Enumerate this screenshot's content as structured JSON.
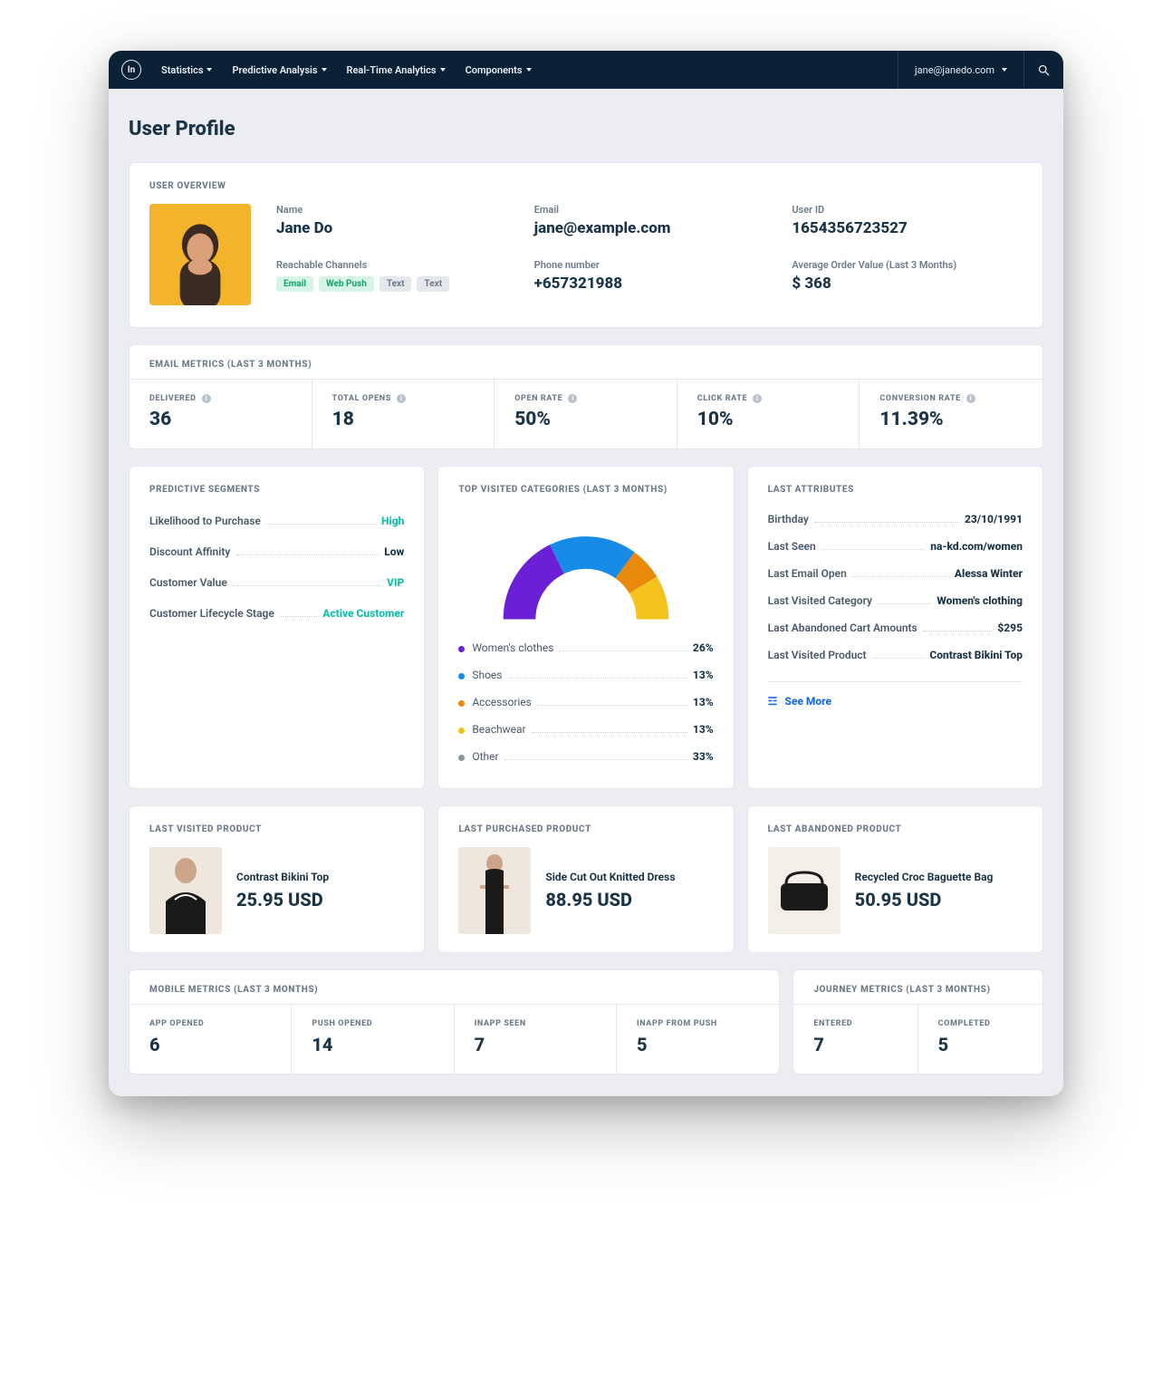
{
  "nav": {
    "items": [
      "Statistics",
      "Predictive Analysis",
      "Real-Time Analytics",
      "Components"
    ],
    "user_email": "jane@janedo.com"
  },
  "page_title": "User Profile",
  "overview": {
    "section_title": "USER OVERVIEW",
    "name_label": "Name",
    "name": "Jane Do",
    "email_label": "Email",
    "email": "jane@example.com",
    "userid_label": "User ID",
    "userid": "1654356723527",
    "channels_label": "Reachable Channels",
    "channels": [
      "Email",
      "Web Push",
      "Text",
      "Text"
    ],
    "phone_label": "Phone number",
    "phone": "+657321988",
    "aov_label": "Average Order Value (Last 3 Months)",
    "aov": "$ 368"
  },
  "email_metrics": {
    "section_title": "EMAIL METRICS (LAST 3 MONTHS)",
    "cells": [
      {
        "label": "DELIVERED",
        "value": "36",
        "info": true
      },
      {
        "label": "TOTAL OPENS",
        "value": "18",
        "info": true
      },
      {
        "label": "OPEN RATE",
        "value": "50%",
        "info": true
      },
      {
        "label": "CLICK RATE",
        "value": "10%",
        "info": true
      },
      {
        "label": "CONVERSION RATE",
        "value": "11.39%",
        "info": true
      }
    ]
  },
  "predictive": {
    "section_title": "PREDICTIVE SEGMENTS",
    "rows": [
      {
        "k": "Likelihood to Purchase",
        "v": "High",
        "teal": true
      },
      {
        "k": "Discount Affinity",
        "v": "Low",
        "teal": false
      },
      {
        "k": "Customer Value",
        "v": "VIP",
        "teal": true
      },
      {
        "k": "Customer Lifecycle Stage",
        "v": "Active Customer",
        "teal": true
      }
    ]
  },
  "categories": {
    "section_title": "TOP VISITED CATEGORIES (LAST 3 MONTHS)",
    "legend": [
      {
        "label": "Women's clothes",
        "pct": "26%",
        "color": "sw-purple"
      },
      {
        "label": "Shoes",
        "pct": "13%",
        "color": "sw-blue"
      },
      {
        "label": "Accessories",
        "pct": "13%",
        "color": "sw-orange"
      },
      {
        "label": "Beachwear",
        "pct": "13%",
        "color": "sw-yellow"
      },
      {
        "label": "Other",
        "pct": "33%",
        "color": "sw-grey"
      }
    ]
  },
  "attributes": {
    "section_title": "LAST ATTRIBUTES",
    "rows": [
      {
        "k": "Birthday",
        "v": "23/10/1991"
      },
      {
        "k": "Last Seen",
        "v": "na-kd.com/women"
      },
      {
        "k": "Last Email Open",
        "v": "Alessa Winter"
      },
      {
        "k": "Last Visited Category",
        "v": "Women's clothing"
      },
      {
        "k": "Last Abandoned Cart Amounts",
        "v": "$295"
      },
      {
        "k": "Last Visited Product",
        "v": "Contrast Bikini Top"
      }
    ],
    "see_more": "See More"
  },
  "products": {
    "last_visited": {
      "title": "LAST VISITED PRODUCT",
      "name": "Contrast Bikini Top",
      "price": "25.95 USD"
    },
    "last_purchased": {
      "title": "LAST PURCHASED PRODUCT",
      "name": "Side Cut Out Knitted Dress",
      "price": "88.95 USD"
    },
    "last_abandoned": {
      "title": "LAST ABANDONED PRODUCT",
      "name": "Recycled Croc Baguette Bag",
      "price": "50.95 USD"
    }
  },
  "mobile": {
    "section_title": "MOBILE METRICS (LAST 3 MONTHS)",
    "cells": [
      {
        "label": "APP OPENED",
        "value": "6"
      },
      {
        "label": "PUSH OPENED",
        "value": "14"
      },
      {
        "label": "INAPP SEEN",
        "value": "7"
      },
      {
        "label": "INAPP FROM PUSH",
        "value": "5"
      }
    ]
  },
  "journey": {
    "section_title": "JOURNEY METRICS (LAST 3 MONTHS)",
    "cells": [
      {
        "label": "ENTERED",
        "value": "7"
      },
      {
        "label": "COMPLETED",
        "value": "5"
      }
    ]
  },
  "chart_data": {
    "type": "pie",
    "title": "Top Visited Categories (Last 3 Months)",
    "series": [
      {
        "name": "share",
        "values": [
          26,
          13,
          13,
          13,
          33
        ]
      }
    ],
    "categories": [
      "Women's clothes",
      "Shoes",
      "Accessories",
      "Beachwear",
      "Other"
    ],
    "colors": [
      "#6b20d6",
      "#178be8",
      "#ea8a0c",
      "#f3c21c",
      "#8a94a3"
    ],
    "note": "rendered as semi-donut; Other slice hidden in arc"
  }
}
